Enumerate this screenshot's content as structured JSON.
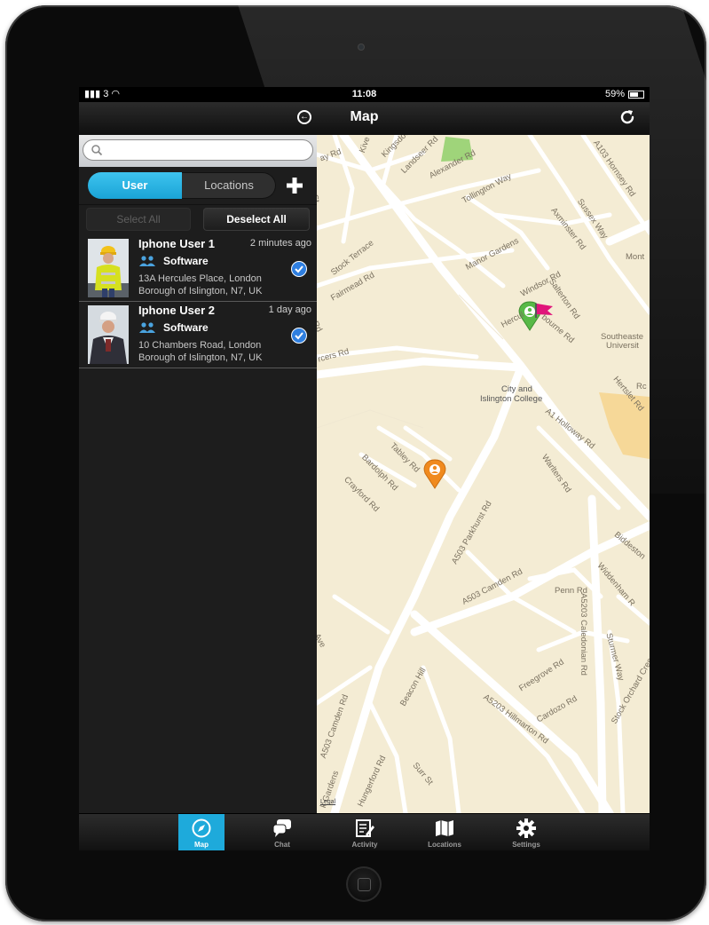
{
  "status": {
    "carrier": "3",
    "time": "11:08",
    "battery": "59%"
  },
  "nav": {
    "title": "Map"
  },
  "search": {
    "placeholder": ""
  },
  "segment": {
    "user": "User",
    "locations": "Locations"
  },
  "actions": {
    "select_all": "Select All",
    "deselect_all": "Deselect All"
  },
  "users": [
    {
      "name": "Iphone User 1",
      "time": "2 minutes ago",
      "group": "Software",
      "address_line1": "13A Hercules Place, London",
      "address_line2": "Borough of Islington, N7, UK",
      "checked": true
    },
    {
      "name": "Iphone User 2",
      "time": "1 day ago",
      "group": "Software",
      "address_line1": "10 Chambers Road, London",
      "address_line2": "Borough of Islington, N7, UK",
      "checked": true
    }
  ],
  "map": {
    "labels": {
      "kingsdown": "Kingsdown",
      "landseer": "Landseer Rd",
      "alexander": "Alexander Rd",
      "tollington": "Tollington Way",
      "hornsey": "A103 Hornsey Rd",
      "sussex": "Sussex Way",
      "axminster": "Axminster Rd",
      "manor": "Manor Gardens",
      "stock_terrace": "Stock Terrace",
      "fairmead": "Fairmead Rd",
      "windsor": "Windsor Rd",
      "salterton": "Salterton Rd",
      "mont": "Mont",
      "hercules": "Hercul",
      "bourne": "bourne Rd",
      "southeastern": "Southeaste",
      "university": "Universit",
      "city_college": "City and",
      "city_college2": "Islington College",
      "hertslet": "Hertslet Rd",
      "a1_holloway": "A1 Holloway Rd",
      "tabley": "Tabley Rd",
      "bardolph": "Bardolph Rd",
      "crayford": "Crayford Rd",
      "parkhurst": "A503 Parkhurst Rd",
      "warlters": "Warlters Rd",
      "biddestone": "Biddeston",
      "camden_a503": "A503 Camden Rd",
      "widdenham": "Widdenham R",
      "penn": "Penn Rd",
      "caledonian": "A5203 Caledonian Rd",
      "freegrove": "Freegrove Rd",
      "sturmer": "Sturmer Way",
      "stock_orchard": "Stock Orchard Crescent",
      "cardozo": "Cardozo Rd",
      "beacon": "Beacon Hill",
      "hillmarton": "A5203 Hillmarton Rd",
      "camden_left": "A503 Camden Rd",
      "hungerford": "Hungerford Rd",
      "surr": "Surr St",
      "gardens": "k Gardens",
      "ave": "Ave",
      "cers": "rcers Rd",
      "st": "St",
      "rd_left": "Rd",
      "legal": "Legal",
      "ay_rd": "ay Rd",
      "kiv": "Kive",
      "rc": "Rc"
    }
  },
  "tabs": [
    {
      "label": "Map",
      "icon": "compass-icon"
    },
    {
      "label": "Chat",
      "icon": "chat-bubble-icon"
    },
    {
      "label": "Activity",
      "icon": "activity-icon"
    },
    {
      "label": "Locations",
      "icon": "map-icon"
    },
    {
      "label": "Settings",
      "icon": "gear-icon"
    }
  ],
  "colors": {
    "accent": "#1eaadb",
    "map_bg": "#f4ecd4",
    "pin_green": "#58b947",
    "pin_orange": "#f08a1e",
    "flag_pink": "#e0157a"
  }
}
